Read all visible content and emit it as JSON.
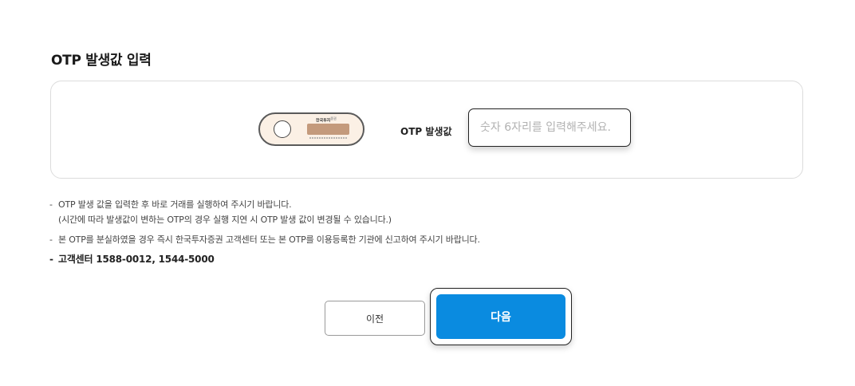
{
  "section": {
    "title": "OTP 발생값 입력"
  },
  "otp": {
    "device_brand": "한국투자",
    "device_brand_sup": "증권",
    "label": "OTP 발생값",
    "input_placeholder": "숫자 6자리를 입력해주세요.",
    "input_value": ""
  },
  "notices": [
    {
      "line1": "OTP 발생 값을 입력한 후 바로 거래를 실행하여 주시기 바랍니다.",
      "line2": "(시간에 따라 발생값이 변하는 OTP의 경우 실행 지연 시 OTP 발생 값이 변경될 수 있습니다.)"
    },
    {
      "line1": "본 OTP를 분실하였을 경우 즉시 한국투자증권 고객센터 또는 본 OTP를 이용등록한 기관에 신고하여 주시기 바랍니다."
    },
    {
      "line1": "고객센터 1588-0012, 1544-5000"
    }
  ],
  "buttons": {
    "prev_label": "이전",
    "next_label": "다음"
  },
  "colors": {
    "primary": "#0a8be0",
    "device_body": "#fbf0e5",
    "device_screen": "#c49a7c"
  }
}
